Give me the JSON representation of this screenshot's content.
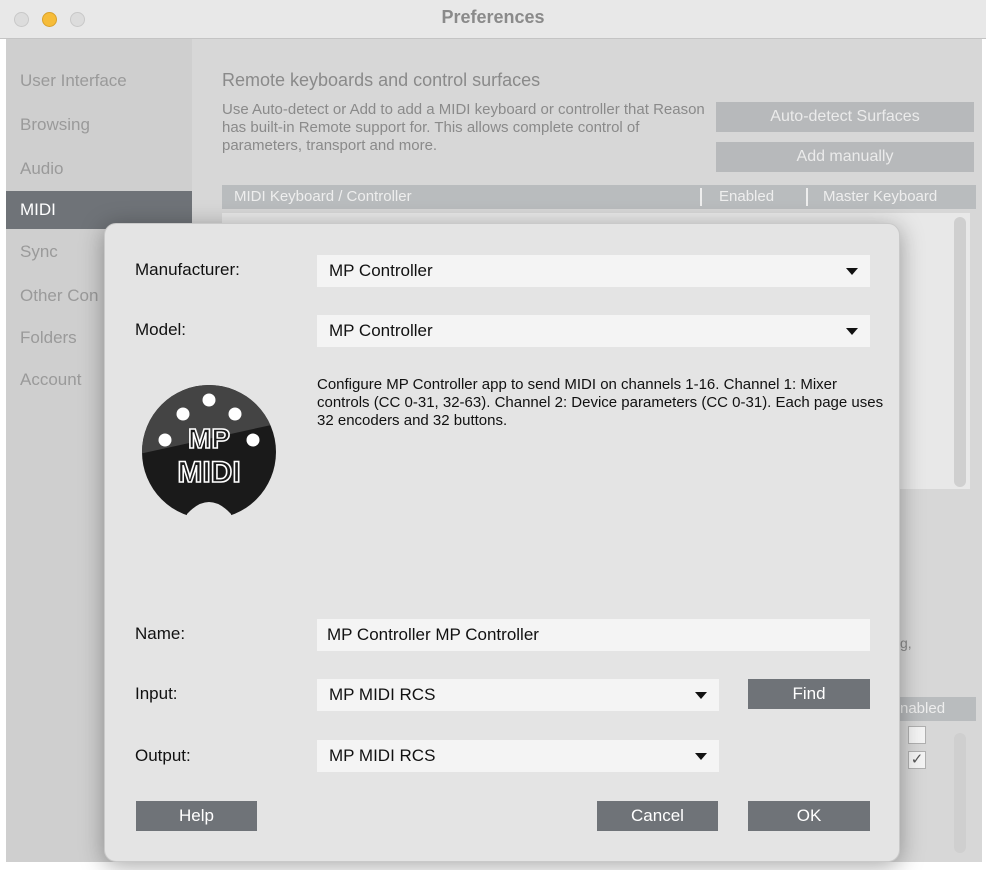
{
  "window": {
    "title": "Preferences"
  },
  "sidebar": {
    "items": [
      {
        "label": "User Interface",
        "active": false
      },
      {
        "label": "Browsing",
        "active": false
      },
      {
        "label": "Audio",
        "active": false
      },
      {
        "label": "MIDI",
        "active": true
      },
      {
        "label": "Sync",
        "active": false
      },
      {
        "label": "Other Con",
        "active": false
      },
      {
        "label": "Folders",
        "active": false
      },
      {
        "label": "Account",
        "active": false
      }
    ]
  },
  "main": {
    "title": "Remote keyboards and control surfaces",
    "description": "Use Auto-detect or Add to add a MIDI keyboard or controller that Reason has built-in Remote support for. This allows complete control of parameters, transport and more.",
    "auto_detect_label": "Auto-detect Surfaces",
    "add_manually_label": "Add manually",
    "table_headers": {
      "controller": "MIDI Keyboard / Controller",
      "enabled": "Enabled",
      "master": "Master Keyboard"
    },
    "lower_partial_text": "g,",
    "lower_header_partial": "nabled",
    "checkbox_1_checked": false,
    "checkbox_2_checked": true,
    "checkmark": "✓"
  },
  "dialog": {
    "manufacturer_label": "Manufacturer:",
    "manufacturer_value": "MP Controller",
    "model_label": "Model:",
    "model_value": "MP Controller",
    "description": "Configure MP Controller app to send MIDI on channels 1-16. Channel 1: Mixer controls (CC 0-31, 32-63). Channel 2: Device parameters (CC 0-31). Each page uses 32 encoders and 32 buttons.",
    "logo": {
      "line1": "MP",
      "line2": "MIDI"
    },
    "name_label": "Name:",
    "name_value": "MP Controller MP Controller",
    "input_label": "Input:",
    "input_value": "MP MIDI RCS",
    "find_label": "Find",
    "output_label": "Output:",
    "output_value": "MP MIDI RCS",
    "help_label": "Help",
    "cancel_label": "Cancel",
    "ok_label": "OK"
  },
  "colors": {
    "accent_dark": "#6f7378",
    "minimize_light": "#f6bc39",
    "dialog_bg": "#e4e4e4"
  },
  "icons": [
    "dropdown-arrow-icon",
    "checkmark-icon",
    "mp-midi-logo"
  ]
}
